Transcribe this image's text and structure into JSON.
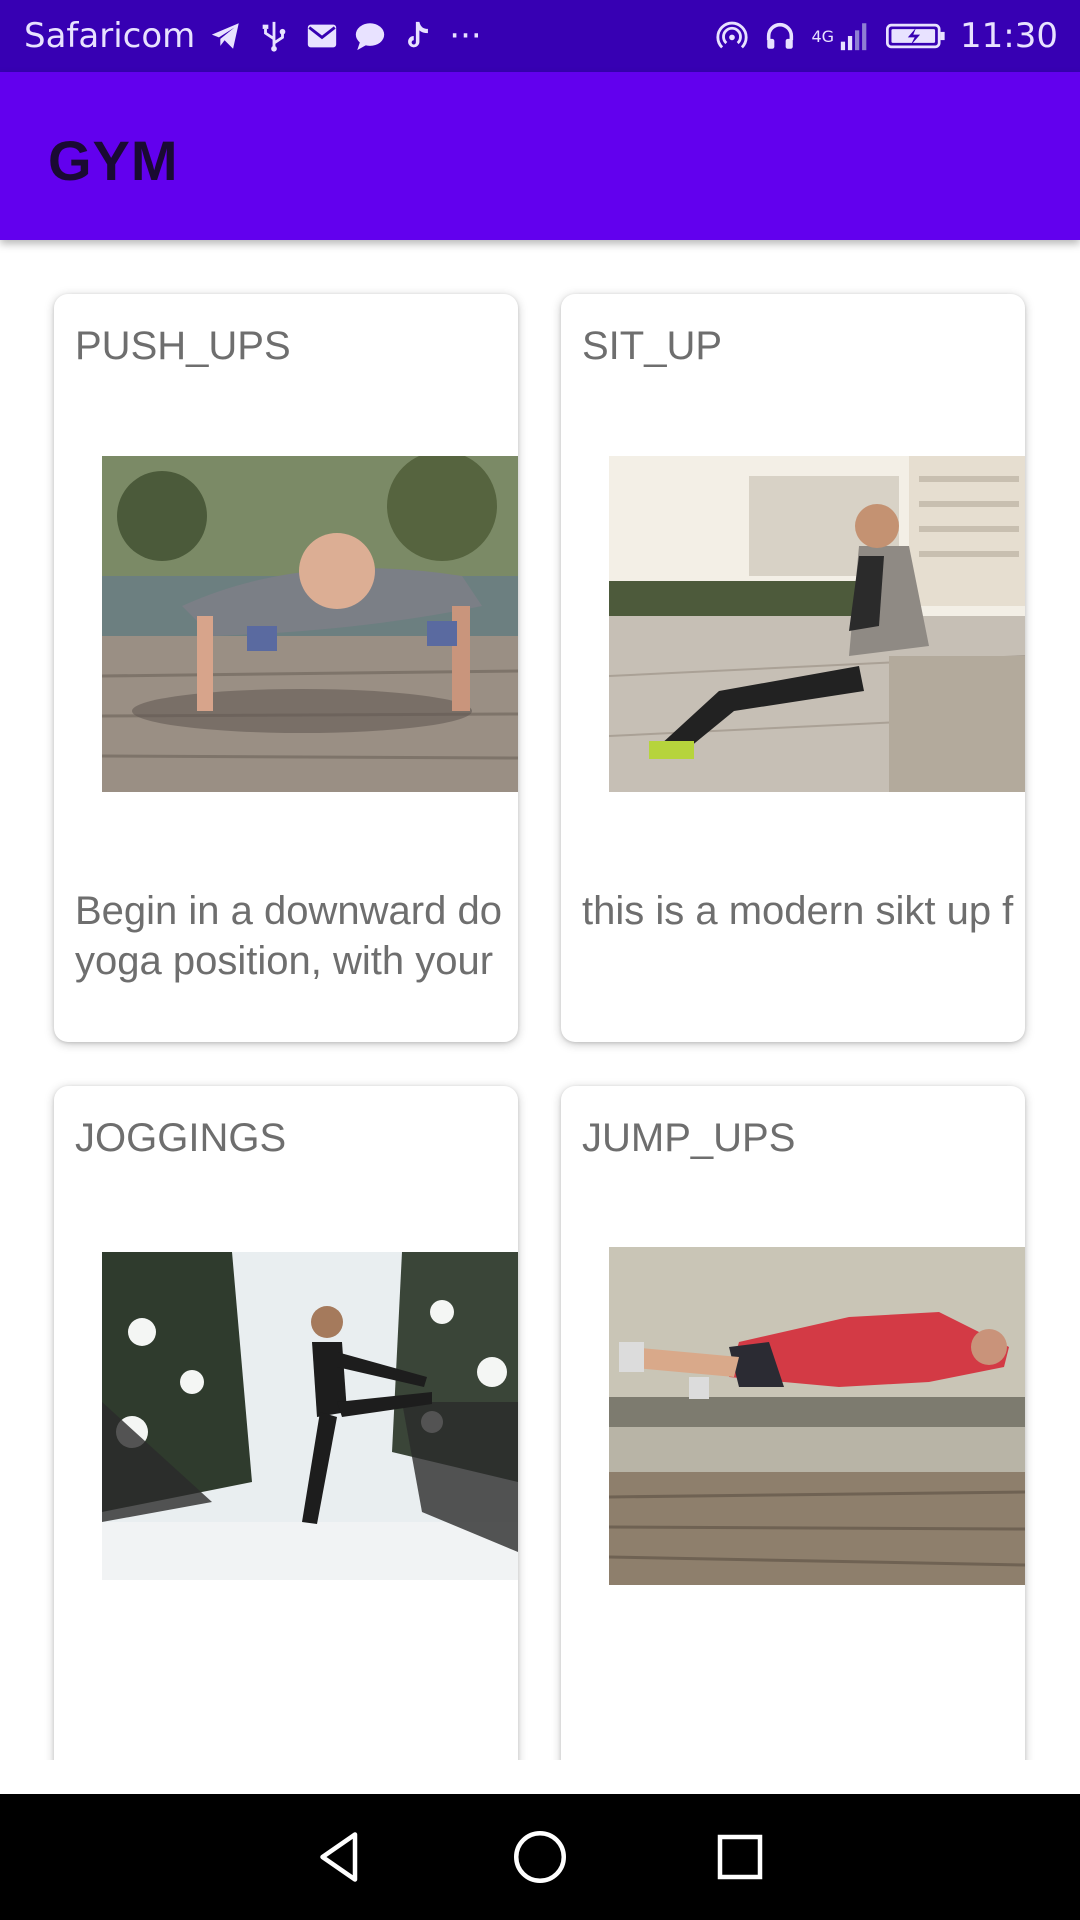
{
  "status_bar": {
    "carrier": "Safaricom",
    "overflow": "···",
    "network": "4G",
    "time": "11:30",
    "icons_left": [
      "telegram-icon",
      "usb-icon",
      "mail-icon",
      "chat-icon",
      "tiktok-icon"
    ],
    "icons_right": [
      "hotspot-icon",
      "headset-icon",
      "signal-icon",
      "battery-icon"
    ]
  },
  "app_bar": {
    "title": "GYM",
    "color": "#6200ee"
  },
  "exercises": [
    {
      "title": "PUSH_UPS",
      "description": "Begin in a downward do\nyoga position, with your",
      "image": "push-ups-photo"
    },
    {
      "title": "SIT_UP",
      "description": "this is a modern sikt up f",
      "image": "sit-up-photo"
    },
    {
      "title": "JOGGINGS",
      "description": "",
      "image": "jogging-photo"
    },
    {
      "title": "JUMP_UPS",
      "description": "",
      "image": "jump-ups-photo"
    }
  ],
  "nav_bar": {
    "buttons": [
      "back-icon",
      "home-icon",
      "recents-icon"
    ]
  },
  "colors": {
    "status_bar": "#3700b3",
    "app_bar": "#6200ee",
    "card_text": "#6e6e6e"
  }
}
